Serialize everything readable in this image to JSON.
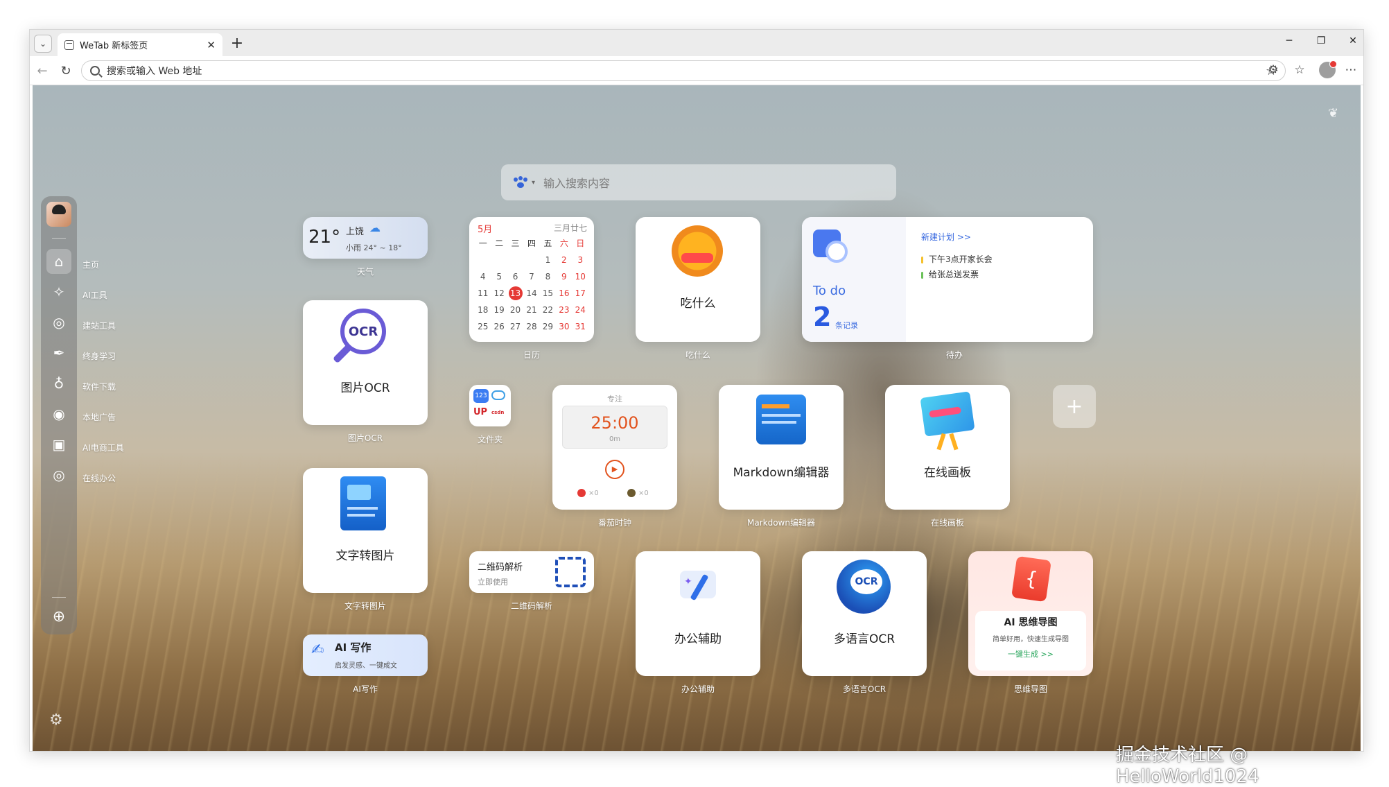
{
  "browser": {
    "tab_title": "WeTab 新标签页",
    "address_placeholder": "搜索或输入 Web 地址"
  },
  "search": {
    "placeholder": "输入搜索内容"
  },
  "sidebar": {
    "items": [
      {
        "label": "主页",
        "icon": "home-icon"
      },
      {
        "label": "AI工具",
        "icon": "sparkle-icon"
      },
      {
        "label": "建站工具",
        "icon": "globe-icon"
      },
      {
        "label": "终身学习",
        "icon": "pen-nib-icon"
      },
      {
        "label": "软件下载",
        "icon": "planet-icon"
      },
      {
        "label": "本地广告",
        "icon": "target-icon"
      },
      {
        "label": "AI电商工具",
        "icon": "shopping-bag-icon"
      },
      {
        "label": "在线办公",
        "icon": "globe-icon"
      }
    ]
  },
  "weather": {
    "temp": "21°",
    "city": "上饶",
    "desc": "小雨 24° ~ 18°",
    "caption": "天气"
  },
  "calendar": {
    "month": "5月",
    "lunar": "三月廿七",
    "weekdays": [
      "一",
      "二",
      "三",
      "四",
      "五",
      "六",
      "日"
    ],
    "days": [
      "",
      "",
      "",
      "",
      "1",
      "2",
      "3",
      "4",
      "5",
      "6",
      "7",
      "8",
      "9",
      "10",
      "11",
      "12",
      "13",
      "14",
      "15",
      "16",
      "17",
      "18",
      "19",
      "20",
      "21",
      "22",
      "23",
      "24",
      "25",
      "26",
      "27",
      "28",
      "29",
      "30",
      "31"
    ],
    "today": "13",
    "caption": "日历"
  },
  "eat": {
    "title": "吃什么",
    "caption": "吃什么"
  },
  "todo": {
    "title": "To do",
    "count": "2",
    "count_label": "条记录",
    "new_plan": "新建计划 >>",
    "items": [
      "下午3点开家长会",
      "给张总送发票"
    ],
    "caption": "待办"
  },
  "ocr": {
    "title": "图片OCR",
    "caption": "图片OCR",
    "logo_text": "OCR"
  },
  "folder": {
    "caption": "文件夹",
    "app1": "123",
    "app2": "UP",
    "app3": "csdn"
  },
  "pomodoro": {
    "label": "专注",
    "time": "25:00",
    "elapsed": "0m",
    "count1": "×0",
    "count2": "×0",
    "caption": "番茄时钟"
  },
  "markdown": {
    "title": "Markdown编辑器",
    "caption": "Markdown编辑器"
  },
  "whiteboard": {
    "title": "在线画板",
    "caption": "在线画板"
  },
  "text2img": {
    "title": "文字转图片",
    "caption": "文字转图片"
  },
  "qrcode": {
    "title": "二维码解析",
    "sub": "立即使用",
    "caption": "二维码解析"
  },
  "office": {
    "title": "办公辅助",
    "caption": "办公辅助"
  },
  "multiocr": {
    "title": "多语言OCR",
    "caption": "多语言OCR",
    "logo_text": "OCR"
  },
  "mindmap": {
    "title": "AI 思维导图",
    "sub": "简单好用，快速生成导图",
    "action": "一键生成 >>",
    "caption": "思维导图"
  },
  "aiwrite": {
    "title": "AI 写作",
    "sub": "启发灵感、一键成文",
    "caption": "AI写作"
  },
  "watermark": "掘金技术社区 @ HelloWorld1024",
  "colors": {
    "accent": "#3564d8",
    "red": "#e53935"
  }
}
